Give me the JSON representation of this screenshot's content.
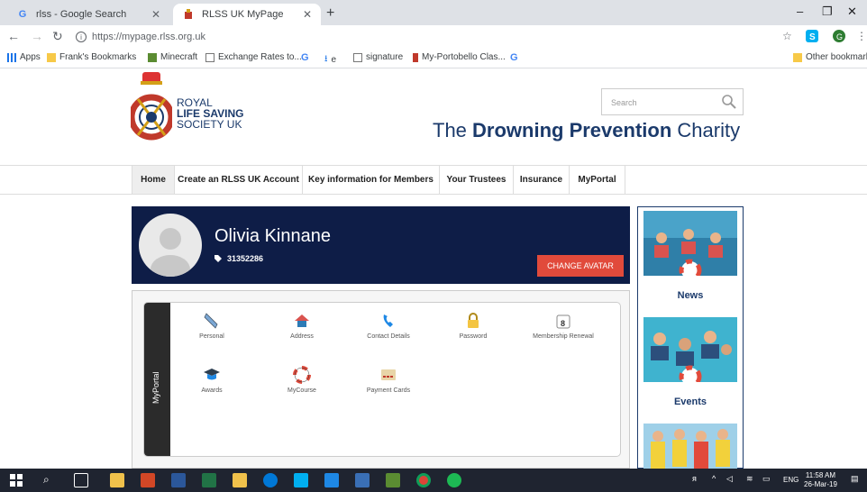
{
  "browser": {
    "tabs": [
      {
        "title": "rlss - Google Search",
        "favicon": "G"
      },
      {
        "title": "RLSS UK MyPage",
        "favicon": "rlss-crest"
      }
    ],
    "url": "https://mypage.rlss.org.uk",
    "bookmarks": [
      {
        "label": "Apps",
        "icon": "apps-grid-icon"
      },
      {
        "label": "Frank's Bookmarks",
        "icon": "folder-icon"
      },
      {
        "label": "Minecraft",
        "icon": "minecraft-icon"
      },
      {
        "label": "Exchange Rates to...",
        "icon": "page-icon"
      },
      {
        "label": "e",
        "icon": "download-icon"
      },
      {
        "label": "signature",
        "icon": "page-icon"
      },
      {
        "label": "My-Portobello Clas...",
        "icon": "bookmark-icon"
      }
    ],
    "other_bookmarks": "Other bookmarks"
  },
  "site": {
    "brand": {
      "line1": "ROYAL",
      "line2": "LIFE SAVING",
      "line3": "SOCIETY UK"
    },
    "search_placeholder": "Search",
    "tagline": {
      "pre": "The ",
      "bold": "Drowning Prevention",
      "post": " Charity"
    },
    "nav": [
      "Home",
      "Create an RLSS UK Account",
      "Key information for Members",
      "Your Trustees",
      "Insurance",
      "MyPortal"
    ]
  },
  "profile": {
    "name": "Olivia Kinnane",
    "member_number": "31352286",
    "change_avatar": "CHANGE AVATAR"
  },
  "portal": {
    "label": "MyPortal",
    "items": [
      {
        "label": "Personal",
        "icon": "pencil-icon"
      },
      {
        "label": "Address",
        "icon": "house-icon"
      },
      {
        "label": "Contact Details",
        "icon": "phone-icon"
      },
      {
        "label": "Password",
        "icon": "padlock-icon"
      },
      {
        "label": "Membership Renewal",
        "icon": "calendar-icon"
      },
      {
        "label": "Awards",
        "icon": "mortarboard-icon"
      },
      {
        "label": "MyCourse",
        "icon": "lifebuoy-icon"
      },
      {
        "label": "Payment Cards",
        "icon": "card-icon"
      }
    ]
  },
  "sidebar": {
    "cards": [
      {
        "label": "News"
      },
      {
        "label": "Events"
      }
    ]
  },
  "taskbar": {
    "lang": "ENG",
    "time": "11:58 AM",
    "date": "26-Mar-19"
  },
  "colors": {
    "navy": "#0e1d47",
    "brand_blue": "#1b3a6b",
    "accent_red": "#e14a3b"
  }
}
